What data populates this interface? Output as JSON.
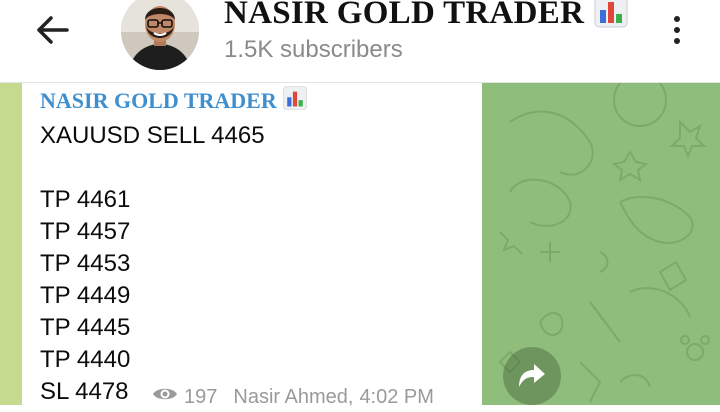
{
  "header": {
    "channel_name": "NASIR GOLD TRADER",
    "subscribers": "1.5K subscribers",
    "back_icon": "arrow-left-icon",
    "menu_icon": "more-vertical-icon"
  },
  "message": {
    "sender": "NASIR GOLD TRADER",
    "lines": [
      "XAUUSD SELL 4465",
      "TP 4461",
      "TP 4457",
      "TP 4453",
      "TP 4449",
      "TP 4445",
      "TP 4440",
      "SL 4478"
    ],
    "views": "197",
    "author": "Nasir Ahmed,",
    "time": "4:02 PM"
  },
  "colors": {
    "chat_background": "#8fbd7b",
    "sender_name": "#3f8fcf",
    "meta_text": "#9a9a9a"
  }
}
